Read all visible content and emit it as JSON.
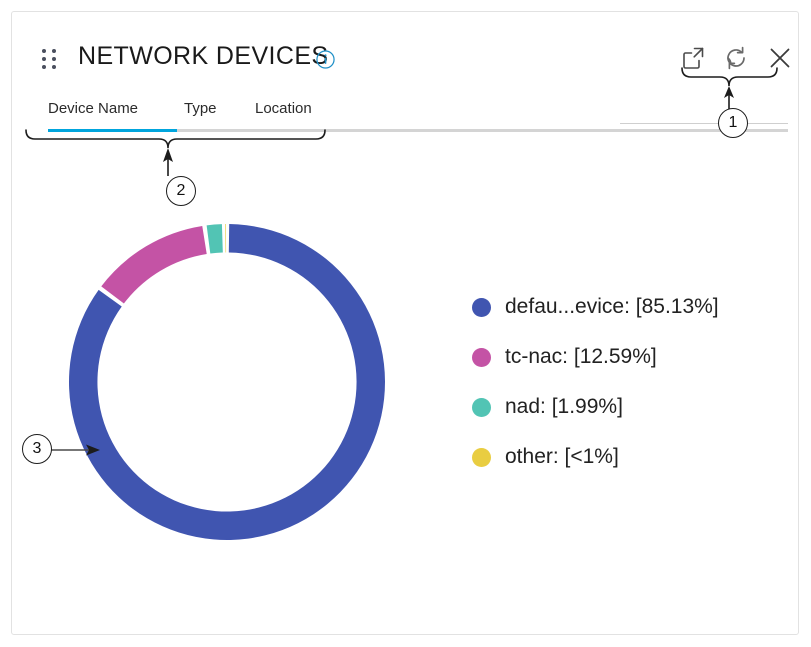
{
  "card": {
    "title": "NETWORK DEVICES",
    "drag_handle_icon": "drag-dots-icon",
    "info_icon": "info-circle-icon"
  },
  "header_actions": [
    {
      "name": "popout-icon",
      "label": "Open in new window"
    },
    {
      "name": "refresh-icon",
      "label": "Refresh"
    },
    {
      "name": "close-icon",
      "label": "Close"
    }
  ],
  "tabs": {
    "items": [
      {
        "label": "Device Name",
        "active": true
      },
      {
        "label": "Type",
        "active": false
      },
      {
        "label": "Location",
        "active": false
      }
    ],
    "active_indicator_color": "#00a5dd",
    "rail_color": "#d4d4d4"
  },
  "legend": {
    "items": [
      {
        "label": "defau...evice: [85.13%]",
        "color": "#4055b0"
      },
      {
        "label": "tc-nac: [12.59%]",
        "color": "#c453a5"
      },
      {
        "label": "nad: [1.99%]",
        "color": "#52c4b4"
      },
      {
        "label": "other: [<1%]",
        "color": "#e9cd41"
      }
    ]
  },
  "annotations": [
    {
      "id": "1",
      "label": "1",
      "target": "header action icons"
    },
    {
      "id": "2",
      "label": "2",
      "target": "tab bar"
    },
    {
      "id": "3",
      "label": "3",
      "target": "donut chart"
    }
  ],
  "chart_data": {
    "type": "pie",
    "variant": "donut",
    "title": "NETWORK DEVICES",
    "categories": [
      "defau...evice",
      "tc-nac",
      "nad",
      "other"
    ],
    "values": [
      85.13,
      12.59,
      1.99,
      0.29
    ],
    "value_labels": [
      "[85.13%]",
      "[12.59%]",
      "[1.99%]",
      "[<1%]"
    ],
    "colors": [
      "#4055b0",
      "#c453a5",
      "#52c4b4",
      "#e9cd41"
    ],
    "units": "percent",
    "start_angle_deg": 0,
    "direction": "clockwise",
    "inner_radius_ratio": 0.82,
    "legend_position": "right",
    "grid": false
  }
}
